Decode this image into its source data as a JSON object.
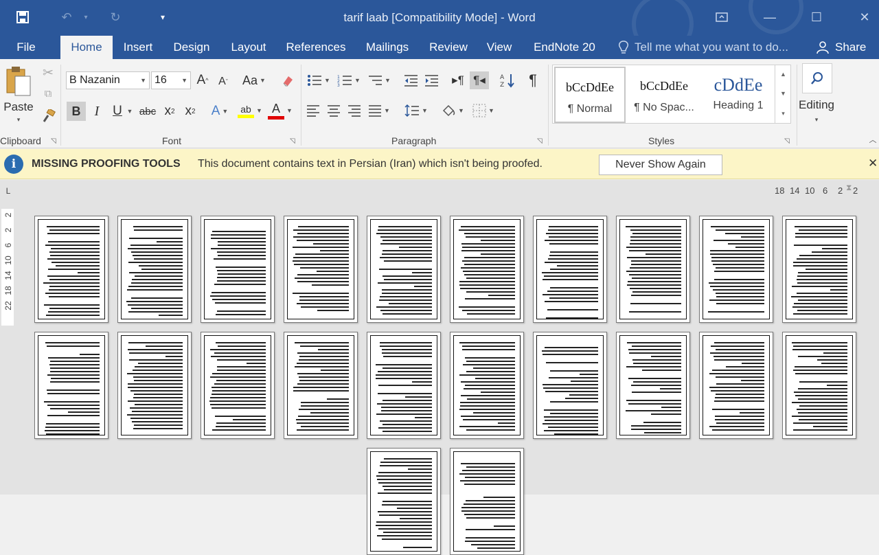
{
  "window": {
    "title": "tarif laab [Compatibility Mode] - Word"
  },
  "quick_access": {
    "save_icon": "save-icon",
    "undo_icon": "undo-icon",
    "redo_icon": "redo-icon",
    "customize_icon": "customize-icon"
  },
  "tabs": [
    {
      "label": "File"
    },
    {
      "label": "Home"
    },
    {
      "label": "Insert"
    },
    {
      "label": "Design"
    },
    {
      "label": "Layout"
    },
    {
      "label": "References"
    },
    {
      "label": "Mailings"
    },
    {
      "label": "Review"
    },
    {
      "label": "View"
    },
    {
      "label": "EndNote 20"
    }
  ],
  "tellme": {
    "text": "Tell me what you want to do..."
  },
  "share": {
    "label": "Share"
  },
  "ribbon": {
    "clipboard": {
      "paste_label": "Paste",
      "group_label": "Clipboard"
    },
    "font": {
      "font_name": "B Nazanin",
      "font_size": "16",
      "case_label": "Aa",
      "bold": "B",
      "italic": "I",
      "underline": "U",
      "strike": "abc",
      "subscript": "x",
      "subscript_mark": "2",
      "superscript": "x",
      "superscript_mark": "2",
      "highlight": "ab",
      "font_color": "A",
      "grow": "A",
      "shrink": "A",
      "group_label": "Font"
    },
    "paragraph": {
      "group_label": "Paragraph"
    },
    "styles": {
      "items": [
        {
          "sample": "bCcDdEe",
          "name": "¶ Normal"
        },
        {
          "sample": "bCcDdEe",
          "name": "¶ No Spac..."
        },
        {
          "sample": "cDdEe",
          "name": "Heading 1"
        }
      ],
      "group_label": "Styles"
    },
    "editing": {
      "label": "Editing"
    }
  },
  "infobar": {
    "title": "MISSING PROOFING TOOLS",
    "message": "This document contains text in Persian (Iran) which isn't being proofed.",
    "button": "Never Show Again"
  },
  "ruler": {
    "h_ticks": [
      "18",
      "14",
      "10",
      "6",
      "2",
      "2"
    ],
    "v_ticks": [
      "2",
      "2",
      "6",
      "10",
      "14",
      "18",
      "22"
    ],
    "corner": "L"
  },
  "colors": {
    "word_blue": "#2b579a",
    "infobar_bg": "#fcf5c7",
    "highlight_yellow": "#ffff00",
    "font_red": "#e00000"
  }
}
